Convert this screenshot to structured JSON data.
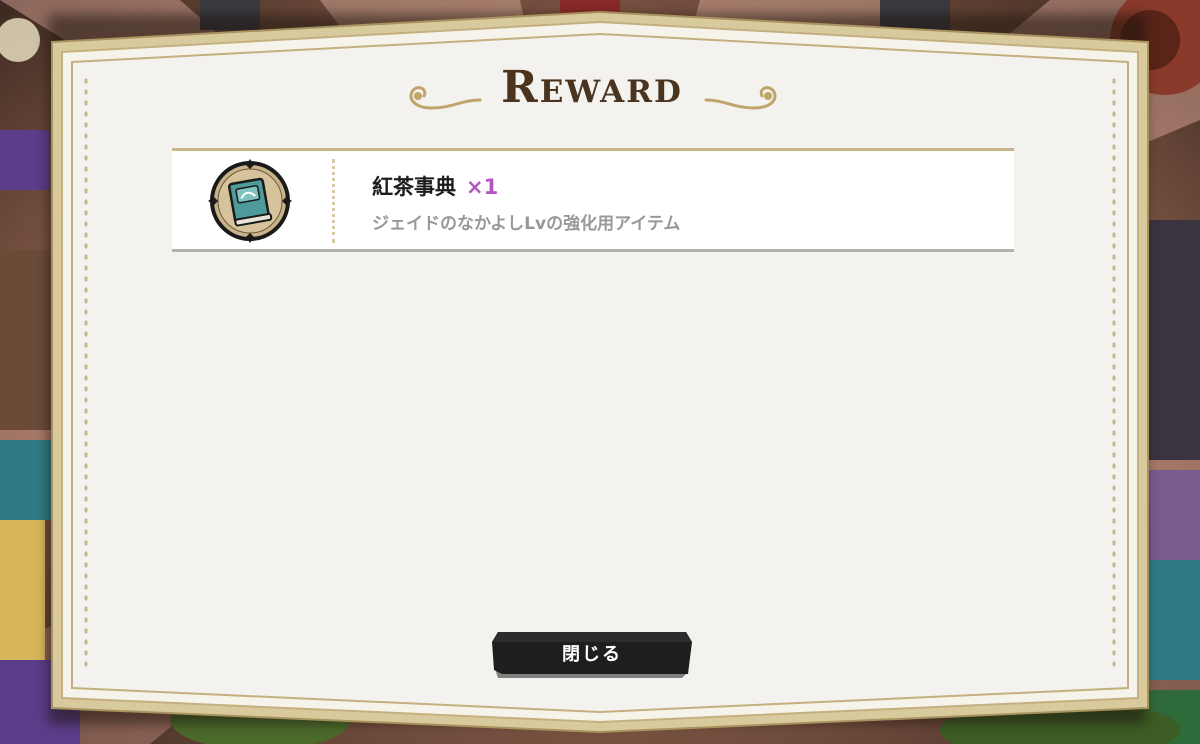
{
  "dialog": {
    "title": "Reward"
  },
  "reward": {
    "item_name": "紅茶事典",
    "quantity": "×1",
    "description": "ジェイドのなかよしLvの強化用アイテム",
    "icon": "book-icon"
  },
  "close_button": {
    "label": "閉じる"
  },
  "colors": {
    "panel_bg": "#f3f2ee",
    "frame_gold": "#c4b07f",
    "title_brown": "#4a3420",
    "quantity_purple": "#b455c2",
    "button_black": "#1e1e1e"
  }
}
